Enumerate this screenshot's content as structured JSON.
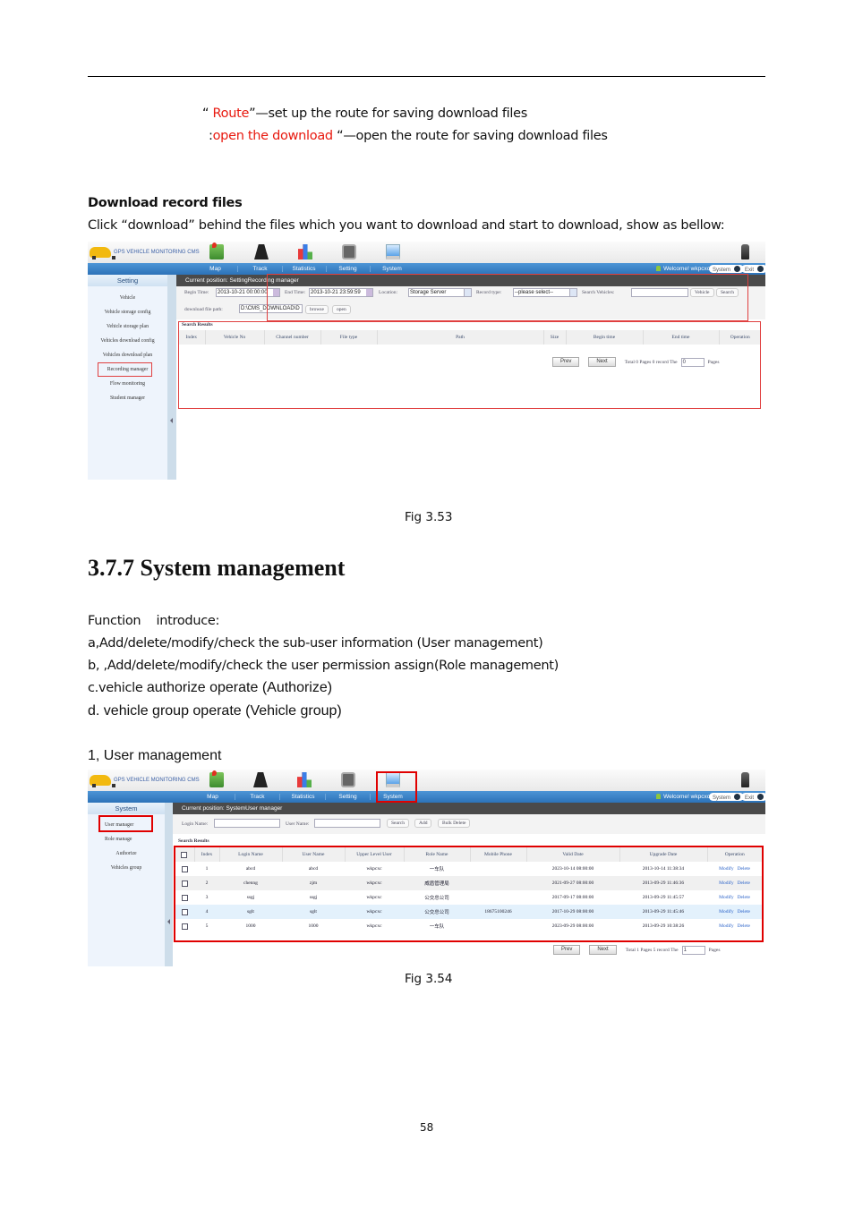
{
  "page": {
    "route_line": {
      "prefix": "“ ",
      "highlight": "Route",
      "rest": "”—set up the route for saving download files"
    },
    "open_line": {
      "prefix": ":",
      "highlight": "open the download",
      "rest": " “—open the route for saving download files"
    },
    "download_heading": "Download record files",
    "download_desc": "Click “download” behind the files which you want to download and start to download, show as bellow:",
    "fig1_caption": "Fig 3.53",
    "section_title": "3.7.7 System management",
    "function_intro": "Function    introduce:",
    "func_a": "a,Add/delete/modify/check the sub-user information (User management)",
    "func_b": "b, ,Add/delete/modify/check the user permission assign(Role management)",
    "func_c_prefix": "c.vehicle ",
    "func_c_rest": "authorize operate (Authorize)",
    "func_d": "d. vehicle group operate (Vehicle group)",
    "user_mgmt_heading": "1, User management",
    "fig2_caption": "Fig 3.54",
    "page_number": "58"
  },
  "app_common": {
    "logo_text": "GPS VEHICLE MONITORING CMS",
    "nav": [
      "Map",
      "Track",
      "Statistics",
      "Setting",
      "System"
    ],
    "welcome": "Welcome!  wkpcxc",
    "system_pill": "System",
    "exit_pill": "Exit"
  },
  "fig1": {
    "sidebar_title": "Setting",
    "sidebar_items": [
      "Vehicle",
      "Vehicle storage config",
      "Vehicle storage plan",
      "Vehicles download config",
      "Vehicles download plan",
      "Recording manager",
      "Flow monitoring",
      "Student manager"
    ],
    "breadcrumb": "Current position: SettingRecording manager",
    "begin_time_label": "Begin Time:",
    "begin_time_value": "2013-10-21 00:00:00",
    "end_time_label": "End Time:",
    "end_time_value": "2013-10-21 23:59:59",
    "location_label": "Location:",
    "location_value": "Storage Server",
    "record_type_label": "Record type:",
    "record_type_value": "--please select--",
    "search_vehicles_label": "Search Vehicles:",
    "search_vehicles_value": "",
    "vehicle_button": "Vehicle",
    "search_button": "Search",
    "download_path_label": "download file path:",
    "download_path_value": "D:\\CMS_DOWNLOAD\\D",
    "browse_button": "browse",
    "open_button": "open",
    "results_title": "Search Results",
    "columns": [
      "Index",
      "Vehicle No",
      "Channel number",
      "File type",
      "Path",
      "Size",
      "Begin time",
      "End time",
      "Operation"
    ],
    "pager": {
      "prev": "Prev",
      "next": "Next",
      "summary": "Total 0 Pages 0 record The",
      "page_value": "0",
      "suffix": "Pages"
    }
  },
  "fig2": {
    "sidebar_title": "System",
    "sidebar_items": [
      "User manager",
      "Role manage",
      "Authorize",
      "Vehicles group"
    ],
    "breadcrumb": "Current position: SystemUser manager",
    "login_name_label": "Login Name:",
    "login_name_value": "",
    "user_name_label": "User Name:",
    "user_name_value": "",
    "search_button": "Search",
    "add_button": "Add",
    "bulk_delete_button": "Bulk Delete",
    "results_title": "Search Results",
    "columns": [
      "",
      "Index",
      "Login Name",
      "User Name",
      "Upper Level User",
      "Role Name",
      "Mobile Phone",
      "Valid Date",
      "Upgrade Date",
      "Operation"
    ],
    "rows": [
      {
        "index": "1",
        "login": "abcd",
        "user": "abcd",
        "upper": "wkpcxc",
        "role": "一车队",
        "phone": "",
        "valid": "2023-10-14 08:00:00",
        "upgrade": "2013-10-14 11:38:34"
      },
      {
        "index": "2",
        "login": "chenng",
        "user": "zjm",
        "upper": "wkpcxc",
        "role": "威盾管理局",
        "phone": "",
        "valid": "2021-09-27 08:00:00",
        "upgrade": "2013-09-29 11:46:36"
      },
      {
        "index": "3",
        "login": "ssgj",
        "user": "ssgj",
        "upper": "wkpcxc",
        "role": "公交总公司",
        "phone": "",
        "valid": "2017-09-17 08:00:00",
        "upgrade": "2013-09-29 11:45:57"
      },
      {
        "index": "4",
        "login": "sglt",
        "user": "sglt",
        "upper": "wkpcxc",
        "role": "公交总公司",
        "phone": "18675100246",
        "valid": "2017-10-29 08:00:00",
        "upgrade": "2013-09-29 11:45:46"
      },
      {
        "index": "5",
        "login": "1000",
        "user": "1000",
        "upper": "wkpcxc",
        "role": "一车队",
        "phone": "",
        "valid": "2023-09-29 08:00:00",
        "upgrade": "2013-09-29 10:38:26"
      }
    ],
    "modify_label": "Modify",
    "delete_label": "Delete",
    "pager": {
      "prev": "Prev",
      "next": "Next",
      "summary": "Total 1 Pages 5 record The",
      "page_value": "1",
      "suffix": "Pages"
    }
  }
}
